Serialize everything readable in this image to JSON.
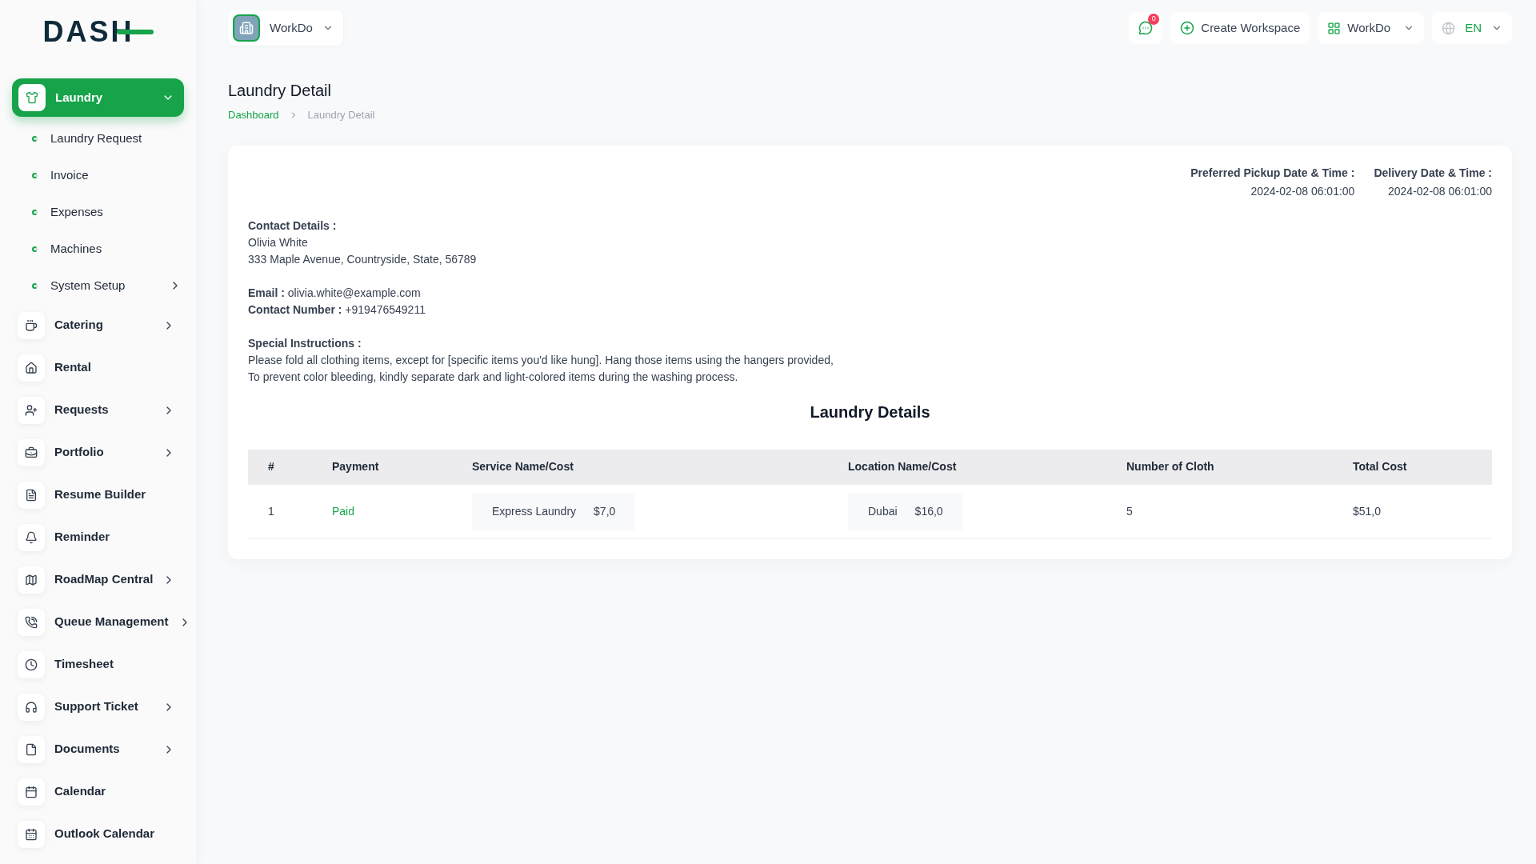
{
  "logo": {
    "text": "DASH"
  },
  "sidebar": {
    "items": [
      {
        "label": "Laundry",
        "selected": true,
        "expanded": true,
        "children": [
          {
            "label": "Laundry Request"
          },
          {
            "label": "Invoice"
          },
          {
            "label": "Expenses"
          },
          {
            "label": "Machines"
          },
          {
            "label": "System Setup",
            "expanded": false
          }
        ]
      },
      {
        "label": "Catering",
        "selected": false,
        "expanded": false
      },
      {
        "label": "Rental",
        "selected": false
      },
      {
        "label": "Requests",
        "selected": false,
        "expanded": false
      },
      {
        "label": "Portfolio",
        "selected": false,
        "expanded": false
      },
      {
        "label": "Resume Builder",
        "selected": false
      },
      {
        "label": "Reminder",
        "selected": false
      },
      {
        "label": "RoadMap Central",
        "selected": false,
        "expanded": false
      },
      {
        "label": "Queue Management",
        "selected": false,
        "expanded": false
      },
      {
        "label": "Timesheet",
        "selected": false
      },
      {
        "label": "Support Ticket",
        "selected": false,
        "expanded": false
      },
      {
        "label": "Documents",
        "selected": false,
        "expanded": false
      },
      {
        "label": "Calendar",
        "selected": false
      },
      {
        "label": "Outlook Calendar",
        "selected": false
      }
    ]
  },
  "topbar": {
    "workspace": "WorkDo",
    "message_count": "0",
    "create_button": "Create Workspace",
    "workspace_menu": "WorkDo",
    "language": "EN"
  },
  "page": {
    "title": "Laundry Detail",
    "breadcrumb": [
      {
        "label": "Dashboard",
        "link": true
      },
      {
        "label": "Laundry Detail",
        "link": false
      }
    ]
  },
  "detail": {
    "dates": [
      {
        "label": "Preferred Pickup Date & Time :",
        "value": "2024-02-08 06:01:00"
      },
      {
        "label": "Delivery Date & Time :",
        "value": "2024-02-08 06:01:00"
      }
    ],
    "contact_heading": "Contact Details :",
    "name": "Olivia White",
    "address": "333 Maple Avenue, Countryside, State, 56789",
    "email_label": "Email :",
    "email": "olivia.white@example.com",
    "phone_label": "Contact Number :",
    "phone": "+919476549211",
    "instructions_heading": "Special Instructions :",
    "instructions": [
      "Please fold all clothing items, except for [specific items you'd like hung]. Hang those items using the hangers provided,",
      "To prevent color bleeding, kindly separate dark and light-colored items during the washing process."
    ]
  },
  "table": {
    "title": "Laundry Details",
    "columns": [
      "#",
      "Payment",
      "Service Name/Cost",
      "Location Name/Cost",
      "Number of Cloth",
      "Total Cost"
    ],
    "rows": [
      {
        "index": "1",
        "payment": "Paid",
        "service": {
          "name": "Express Laundry",
          "cost": "$7,0"
        },
        "location": {
          "name": "Dubai",
          "cost": "$16,0"
        },
        "cloths": "5",
        "total": "$51,0"
      }
    ]
  }
}
